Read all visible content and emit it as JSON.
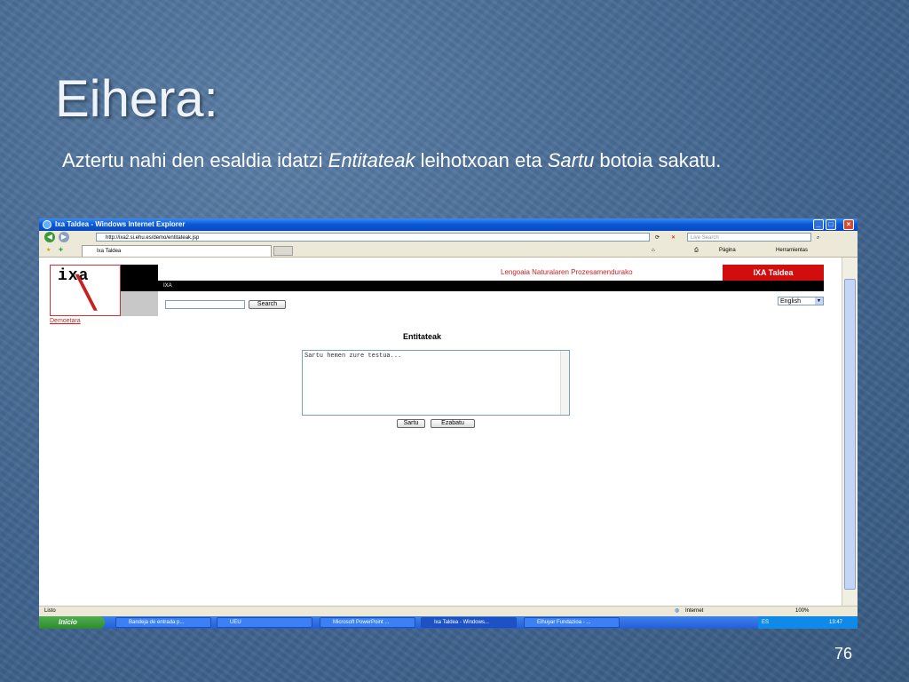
{
  "slide": {
    "title": "Eihera:",
    "subtitle_parts": [
      "Aztertu nahi den esaldia idatzi ",
      "Entitateak",
      " leihotxoan eta ",
      "Sartu",
      " botoia sakatu."
    ],
    "page_number": "76"
  },
  "browser": {
    "window_title": "Ixa Taldea - Windows Internet Explorer",
    "address": "http://ixa2.si.ehu.es/demo/entitateak.jsp",
    "live_search_placeholder": "Live Search",
    "tab_label": "Ixa Taldea",
    "commands": {
      "page": "Página",
      "tools": "Herramientas"
    },
    "status_left": "Listo",
    "status_zone": "Internet",
    "zoom": "100%"
  },
  "page": {
    "logo_text": "ixa",
    "demo_link": "Demoetara",
    "header_text": "Lengoaia Naturalaren Prozesamendurako",
    "brand": "IXA Taldea",
    "bar_text": "IXA",
    "search_button": "Search",
    "language": "English",
    "section_title": "Entitateak",
    "textarea_placeholder": "Sartu hemen zure testua...",
    "submit_button": "Sartu",
    "clear_button": "Ezabatu"
  },
  "taskbar": {
    "start": "Inicio",
    "items": [
      "Bandeja de entrada p...",
      "UEU",
      "Microsoft PowerPoint ...",
      "Ixa Taldea - Windows...",
      "Elhuyar Fundazioa - ..."
    ],
    "lang": "ES",
    "time": "13:47"
  }
}
